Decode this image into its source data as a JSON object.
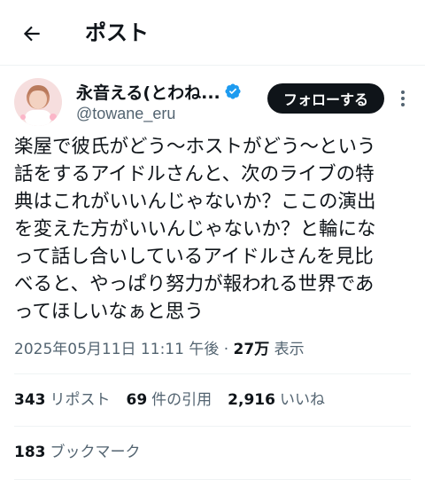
{
  "header": {
    "title": "ポスト",
    "back_icon": "arrow-left-icon"
  },
  "author": {
    "display_name": "永音える(とわね...",
    "handle": "@towane_eru",
    "verified_icon": "verified-badge-icon",
    "verified_color": "#1d9bf0",
    "follow_label": "フォローする",
    "more_icon": "more-vertical-icon"
  },
  "post": {
    "text": "楽屋で彼氏がどう〜ホストがどう〜という\n話をするアイドルさんと、次のライブの特\n典はこれがいいんじゃないか？ここの演出\nを変えた方がいいんじゃないか？と輪にな\nって話し合いしているアイドルさんを見比\nべると、やっぱり努力が報われる世界であ\nってほしいなぁと思う",
    "timestamp": "2025年05月11日 11:11 午後",
    "separator": "·",
    "views_count": "27万",
    "views_label": "表示"
  },
  "stats": {
    "reposts_count": "343",
    "reposts_label": "リポスト",
    "quotes_count": "69",
    "quotes_label": "件の引用",
    "likes_count": "2,916",
    "likes_label": "いいね",
    "bookmarks_count": "183",
    "bookmarks_label": "ブックマーク"
  }
}
